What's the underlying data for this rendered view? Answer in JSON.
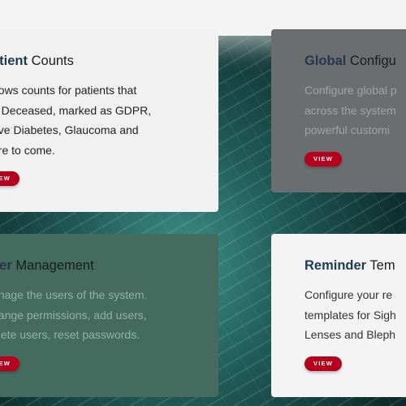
{
  "cards": [
    {
      "title_highlight": "atient",
      "title_rest": " Counts",
      "desc": [
        "hows counts for patients that",
        "e Deceased, marked as GDPR,",
        "ave Diabetes, Glaucoma and",
        "ore to come."
      ],
      "button": "VIEW"
    },
    {
      "title_highlight": "Global",
      "title_rest": " Configu",
      "desc": [
        "Configure global p",
        "across the system",
        "powerful customi"
      ],
      "button": "VIEW"
    },
    {
      "title_highlight": "ser",
      "title_rest": " Management",
      "desc": [
        "anage the users of the system.",
        "hange permissions, add users,",
        "elete users, reset passwords."
      ],
      "button": "VIEW"
    },
    {
      "title_highlight": "Reminder",
      "title_rest": " Tem",
      "desc": [
        "Configure your re",
        "templates for Sigh",
        "Lenses and Bleph"
      ],
      "button": "VIEW"
    }
  ],
  "colors": {
    "button": "#b5001e",
    "title_highlight": "#1e3a4f"
  }
}
